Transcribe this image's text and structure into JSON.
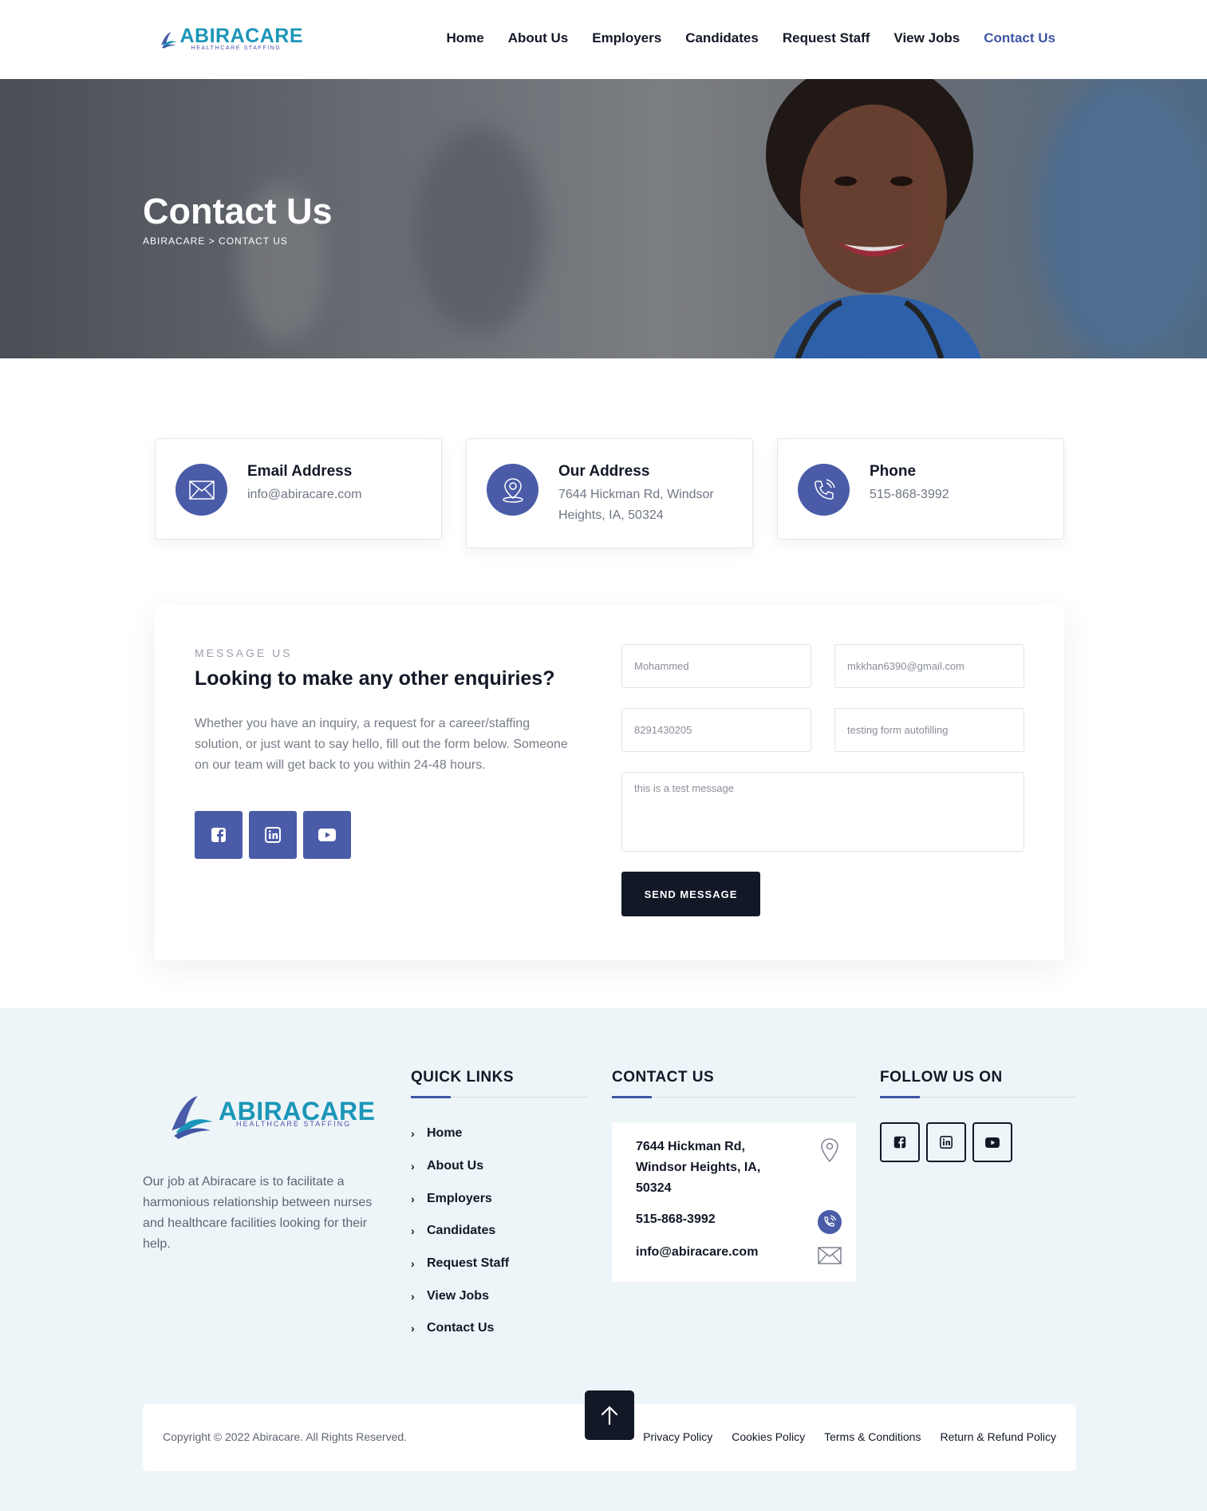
{
  "brand": {
    "name": "ABIRACARE",
    "tagline": "HEALTHCARE STAFFING",
    "primary_color": "#4a5ba8",
    "accent_color": "#1b96b8",
    "dark_color": "#121826"
  },
  "nav": {
    "items": [
      "Home",
      "About Us",
      "Employers",
      "Candidates",
      "Request Staff",
      "View Jobs",
      "Contact Us"
    ],
    "active": "Contact Us"
  },
  "hero": {
    "title": "Contact Us",
    "breadcrumb": "ABIRACARE > CONTACT US"
  },
  "info_cards": [
    {
      "title": "Email Address",
      "value": "info@abiracare.com",
      "icon": "envelope-icon"
    },
    {
      "title": "Our Address",
      "value": "7644 Hickman Rd, Windsor Heights, IA, 50324",
      "icon": "map-pin-icon"
    },
    {
      "title": "Phone",
      "value": "515-868-3992",
      "icon": "phone-icon"
    }
  ],
  "message": {
    "kicker": "MESSAGE US",
    "heading": "Looking to make any other enquiries?",
    "lead": "Whether you have an inquiry, a request for a career/staffing solution, or just want to say hello, fill out the form below. Someone on our team will get back to you within 24-48 hours.",
    "social": [
      "facebook-icon",
      "linkedin-icon",
      "youtube-icon"
    ]
  },
  "form": {
    "name": "Mohammed",
    "email": "mkkhan6390@gmail.com",
    "phone": "8291430205",
    "subject": "testing form autofilling",
    "message": "this is a test message",
    "submit_label": "SEND MESSAGE"
  },
  "footer": {
    "about": "Our job at Abiracare is to facilitate a harmonious relationship between nurses and healthcare facilities looking for their help.",
    "quick_links_title": "QUICK LINKS",
    "quick_links": [
      "Home",
      "About Us",
      "Employers",
      "Candidates",
      "Request Staff",
      "View Jobs",
      "Contact Us"
    ],
    "contact_title": "CONTACT US",
    "contact": {
      "address": "7644 Hickman Rd, Windsor Heights, IA, 50324",
      "phone": "515-868-3992",
      "email": "info@abiracare.com"
    },
    "follow_title": "FOLLOW US ON",
    "copyright": "Copyright © 2022 Abiracare. All Rights Reserved.",
    "legal": [
      "Privacy Policy",
      "Cookies Policy",
      "Terms & Conditions",
      "Return & Refund Policy"
    ]
  }
}
